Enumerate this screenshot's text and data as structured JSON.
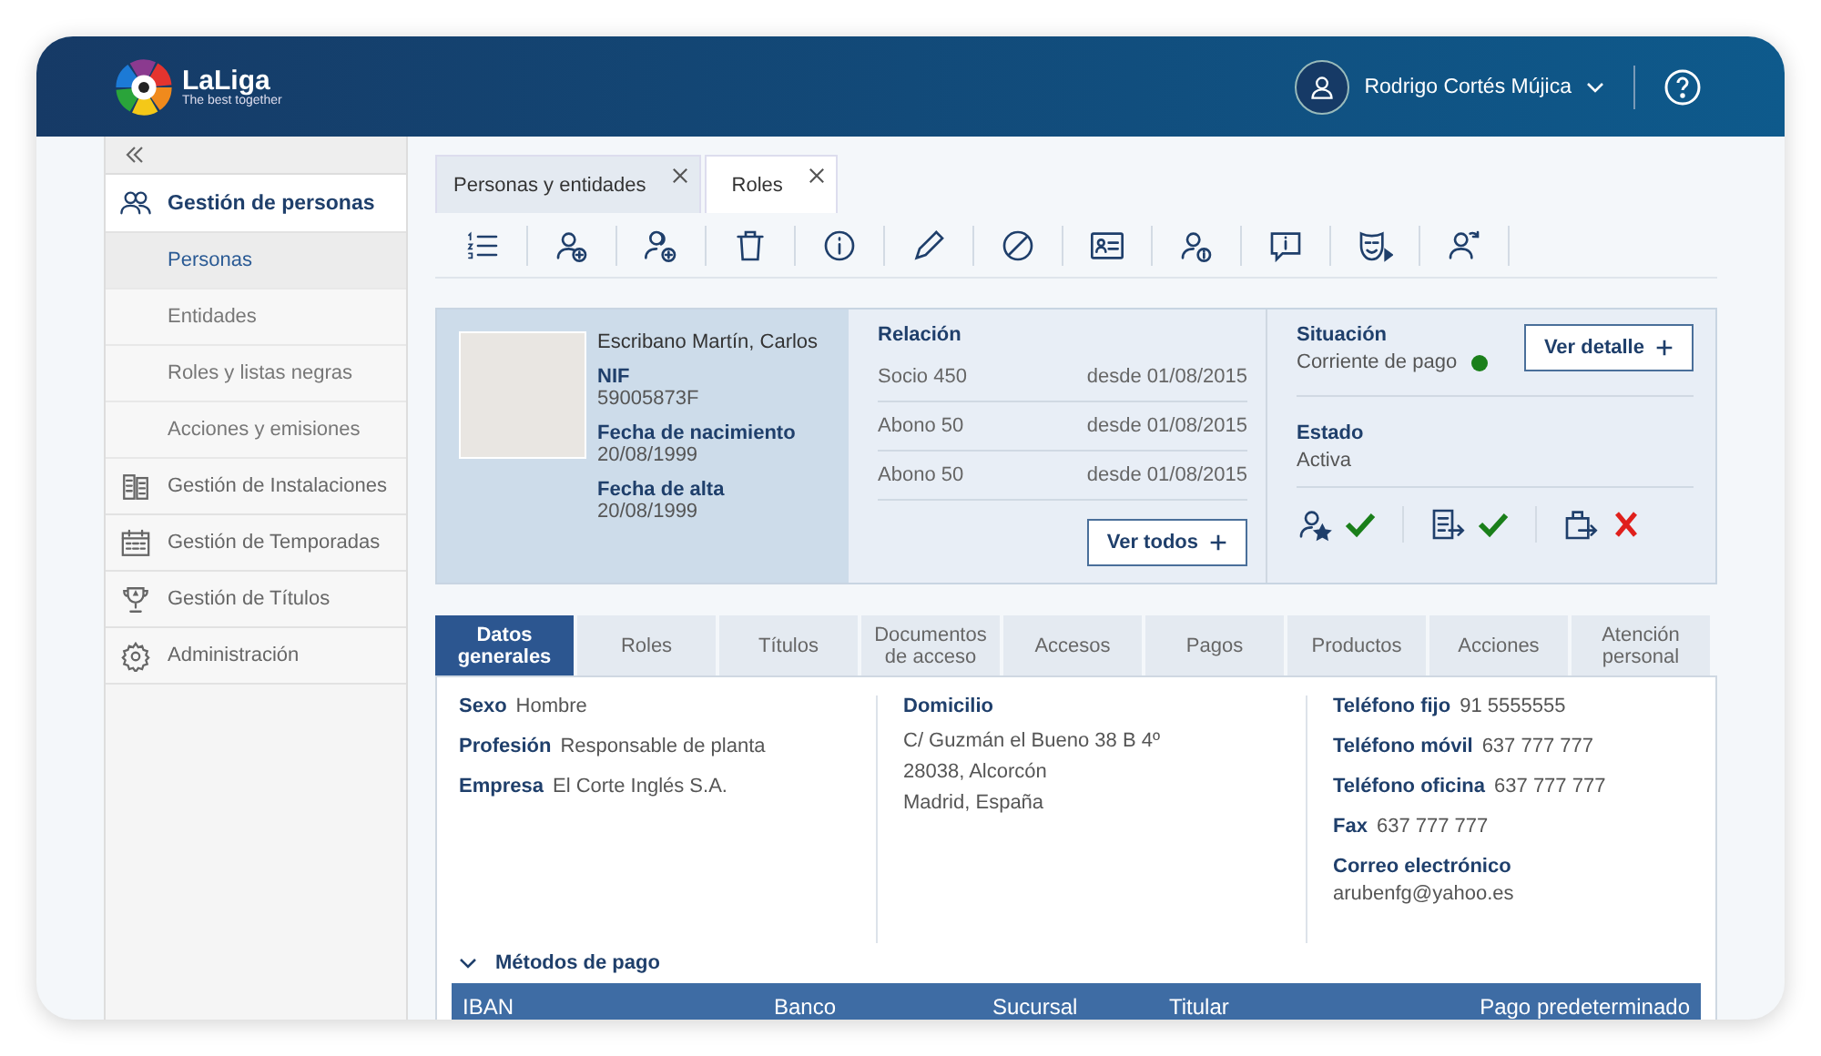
{
  "header": {
    "logo": {
      "name": "LaLiga",
      "tagline": "The best together"
    },
    "user": {
      "name": "Rodrigo Cortés Mújica"
    }
  },
  "sidebar": {
    "items": [
      {
        "label": "Gestión de personas",
        "kind": "people",
        "selected": true,
        "children": [
          {
            "label": "Personas",
            "selected": true
          },
          {
            "label": "Entidades",
            "selected": false
          },
          {
            "label": "Roles y listas negras",
            "selected": false
          },
          {
            "label": "Acciones y emisiones",
            "selected": false
          }
        ]
      },
      {
        "label": "Gestión de Instalaciones",
        "kind": "building",
        "selected": false
      },
      {
        "label": "Gestión de Temporadas",
        "kind": "calendar",
        "selected": false
      },
      {
        "label": "Gestión de Títulos",
        "kind": "trophy",
        "selected": false
      },
      {
        "label": "Administración",
        "kind": "gear",
        "selected": false
      }
    ]
  },
  "doc_tabs": [
    {
      "label": "Personas y entidades",
      "selected": false
    },
    {
      "label": "Roles",
      "selected": true
    }
  ],
  "toolbar": [
    {
      "kind": "list"
    },
    {
      "kind": "user-add"
    },
    {
      "kind": "users-add"
    },
    {
      "kind": "trash"
    },
    {
      "kind": "info"
    },
    {
      "kind": "pencil"
    },
    {
      "kind": "ban"
    },
    {
      "kind": "id-card"
    },
    {
      "kind": "user-info"
    },
    {
      "kind": "message-info"
    },
    {
      "kind": "mask"
    },
    {
      "kind": "user-forward"
    }
  ],
  "profile": {
    "name": "Escribano Martín, Carlos",
    "fields": [
      {
        "label": "NIF",
        "value": "59005873F"
      },
      {
        "label": "Fecha de nacimiento",
        "value": "20/08/1999"
      },
      {
        "label": "Fecha de alta",
        "value": "20/08/1999"
      }
    ]
  },
  "relation": {
    "title": "Relación",
    "rows": [
      {
        "name": "Socio 450",
        "since": "desde 01/08/2015"
      },
      {
        "name": "Abono 50",
        "since": "desde 01/08/2015"
      },
      {
        "name": "Abono 50",
        "since": "desde 01/08/2015"
      }
    ],
    "button": "Ver todos"
  },
  "situation": {
    "label": "Situación",
    "value": "Corriente de pago",
    "color": "#1a7f1a",
    "button": "Ver detalle"
  },
  "estado": {
    "label": "Estado",
    "value": "Activa"
  },
  "checks": [
    {
      "kind": "user-star",
      "ok": true
    },
    {
      "kind": "document",
      "ok": true
    },
    {
      "kind": "bag",
      "ok": false
    }
  ],
  "detail_tabs": [
    {
      "label": "Datos generales",
      "selected": true
    },
    {
      "label": "Roles",
      "selected": false
    },
    {
      "label": "Títulos",
      "selected": false
    },
    {
      "label": "Documentos de acceso",
      "selected": false
    },
    {
      "label": "Accesos",
      "selected": false
    },
    {
      "label": "Pagos",
      "selected": false
    },
    {
      "label": "Productos",
      "selected": false
    },
    {
      "label": "Acciones",
      "selected": false
    },
    {
      "label": "Atención personal",
      "selected": false
    }
  ],
  "personal": [
    {
      "label": "Sexo",
      "value": "Hombre"
    },
    {
      "label": "Profesión",
      "value": "Responsable de planta"
    },
    {
      "label": "Empresa",
      "value": "El Corte Inglés S.A."
    }
  ],
  "address": {
    "title": "Domicilio",
    "lines": [
      "C/ Guzmán el Bueno 38 B 4º",
      "28038, Alcorcón",
      "Madrid, España"
    ]
  },
  "contacts": [
    {
      "label": "Teléfono fijo",
      "value": "91 5555555",
      "kind": "inline"
    },
    {
      "label": "Teléfono móvil",
      "value": "637 777 777",
      "kind": "inline"
    },
    {
      "label": "Teléfono oficina",
      "value": "637 777 777",
      "kind": "inline"
    },
    {
      "label": "Fax",
      "value": "637 777 777",
      "kind": "inline"
    },
    {
      "label": "Correo electrónico",
      "value": "arubenfg@yahoo.es",
      "kind": "stacked"
    }
  ],
  "payment": {
    "title": "Métodos de pago",
    "expanded": true,
    "columns": [
      "IBAN",
      "Banco",
      "Sucursal",
      "Titular",
      "Pago predeterminado"
    ]
  }
}
